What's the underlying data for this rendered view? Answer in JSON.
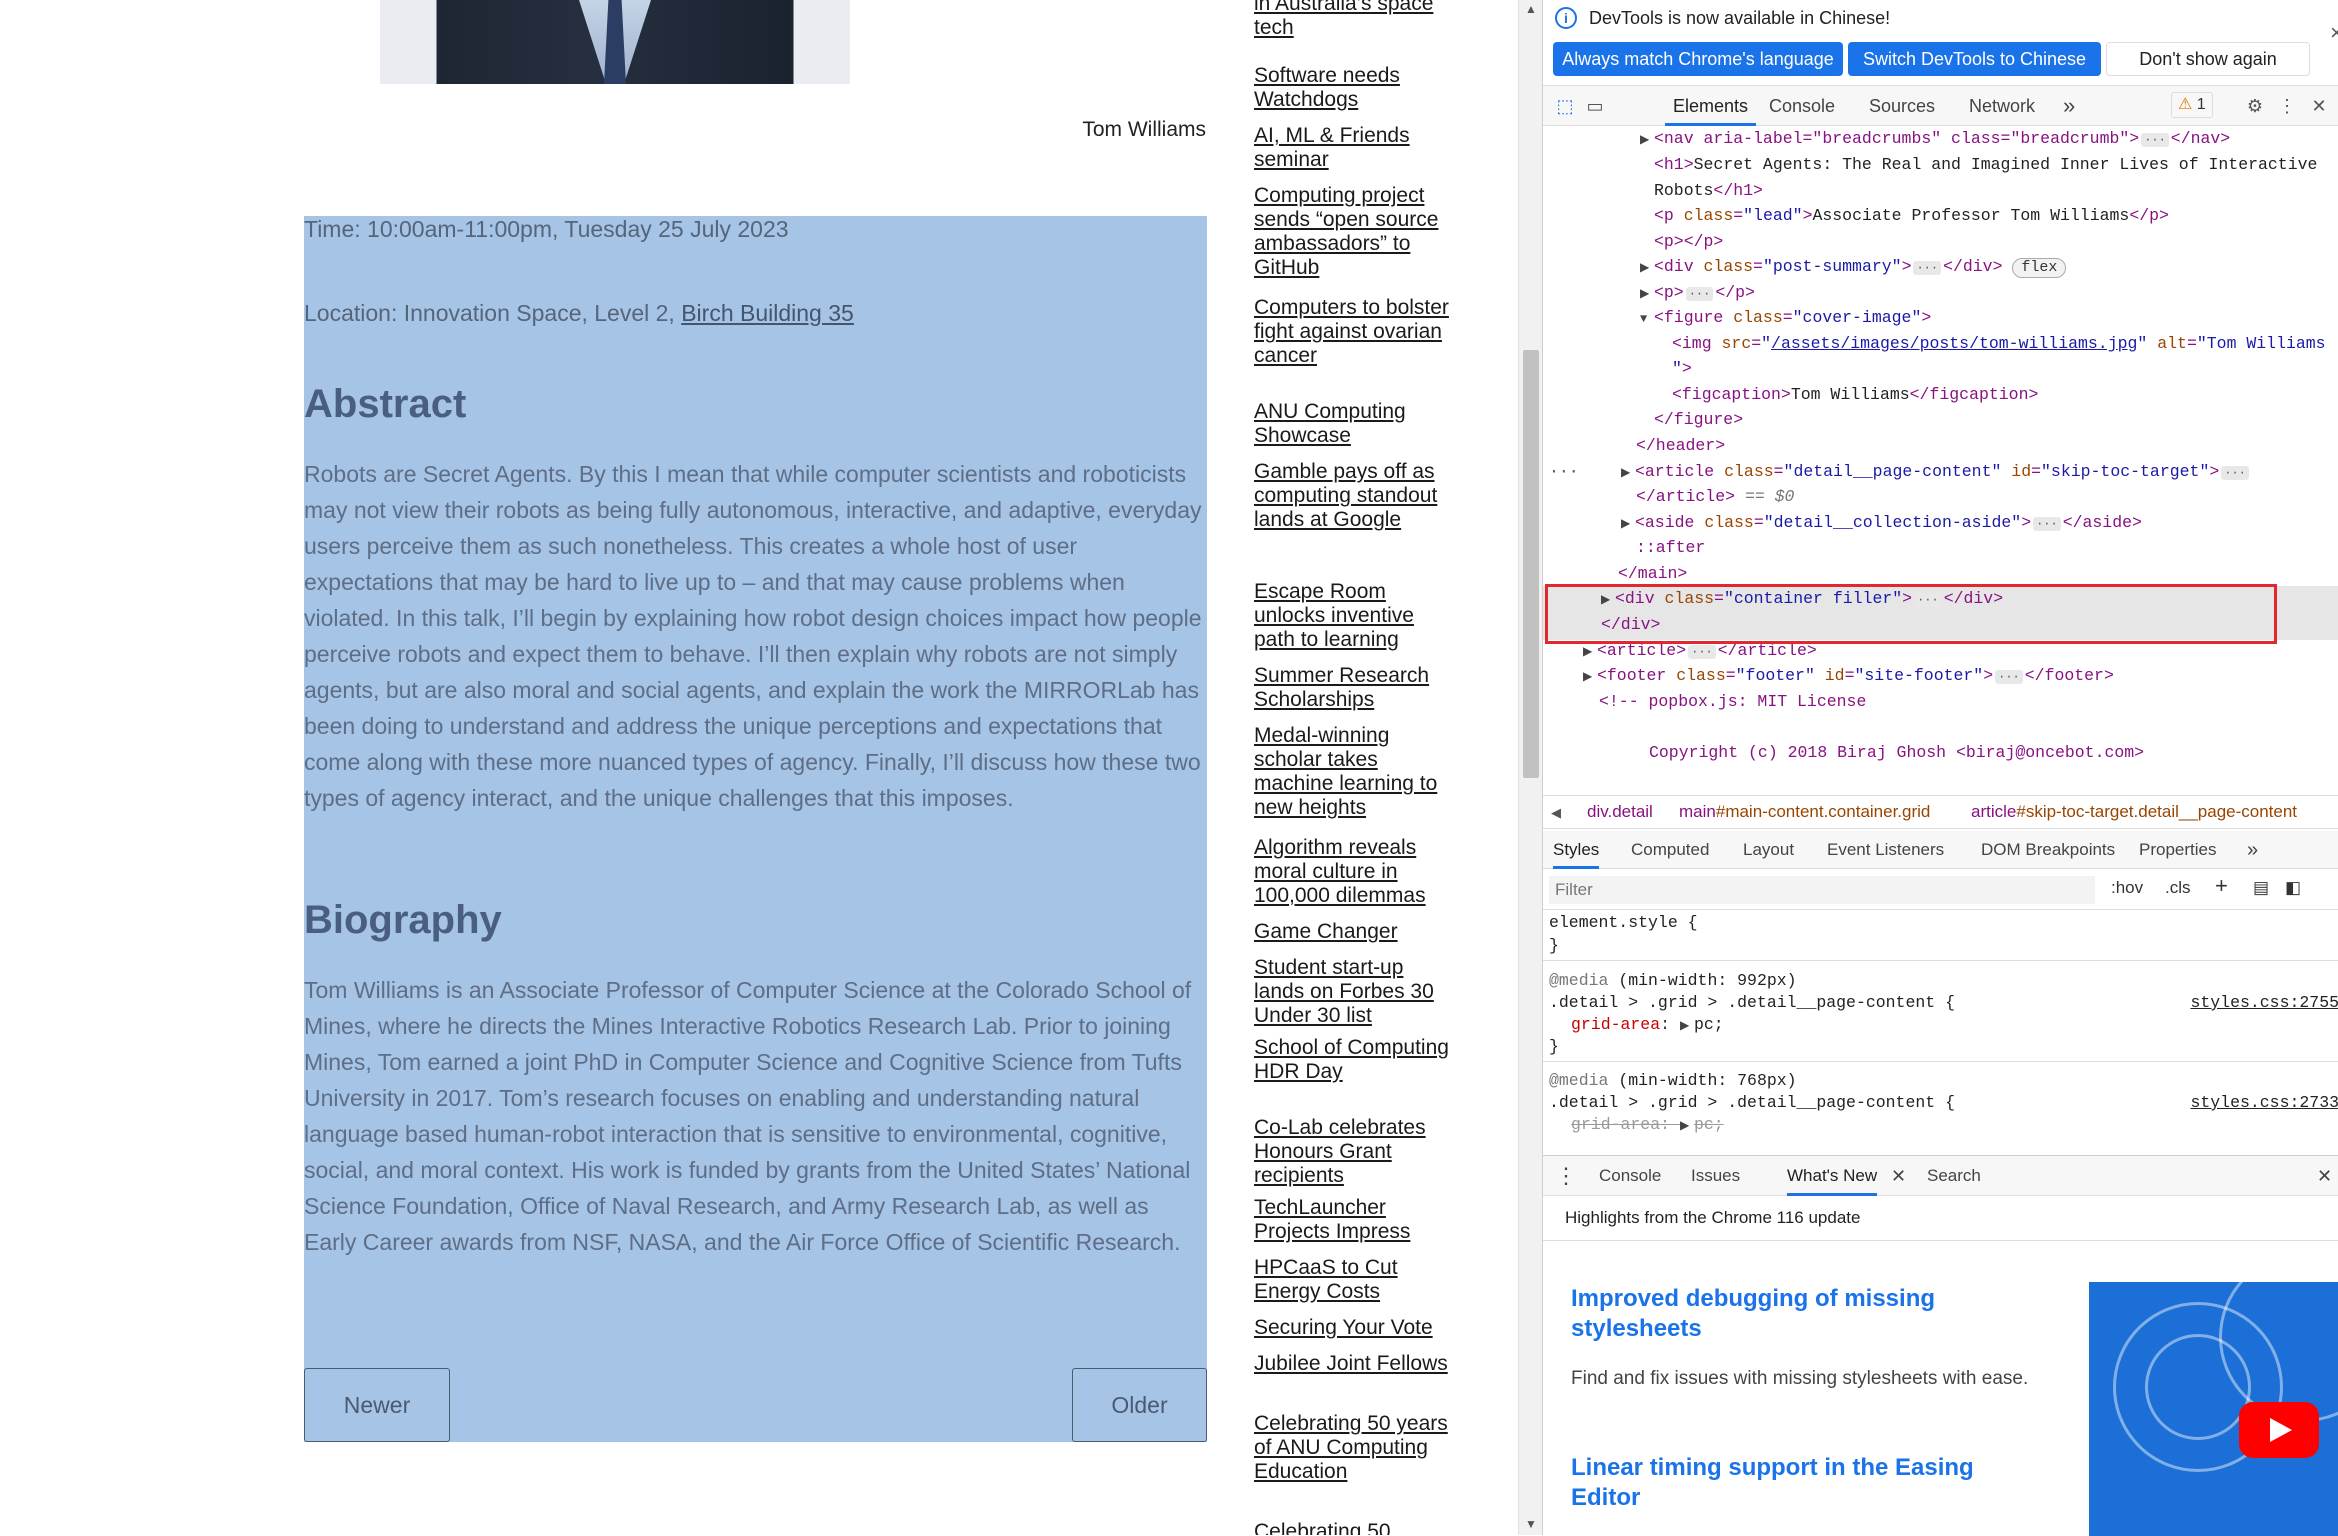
{
  "page": {
    "photo_alt": "Tom Williams",
    "caption": "Tom Williams",
    "article": {
      "time": "Time: 10:00am-11:00pm, Tuesday 25 July 2023",
      "location_prefix": "Location: Innovation Space, Level 2, ",
      "location_link": "Birch Building 35",
      "abstract_heading": "Abstract",
      "abstract_text": "Robots are Secret Agents. By this I mean that while computer scientists and roboticists may not view their robots as being fully autonomous, interactive, and adaptive, everyday users perceive them as such nonetheless. This creates a whole host of user expectations that may be hard to live up to – and that may cause problems when violated. In this talk, I’ll begin by explaining how robot design choices impact how people perceive robots and expect them to behave. I’ll then explain why robots are not simply agents, but are also moral and social agents, and explain the work the MIRRORLab has been doing to understand and address the unique perceptions and expectations that come along with these more nuanced types of agency. Finally, I’ll discuss how these two types of agency interact, and the unique challenges that this imposes.",
      "bio_heading": "Biography",
      "bio_text": "Tom Williams is an Associate Professor of Computer Science at the Colorado School of Mines, where he directs the Mines Interactive Robotics Research Lab. Prior to joining Mines, Tom earned a joint PhD in Computer Science and Cognitive Science from Tufts University in 2017. Tom’s research focuses on enabling and understanding natural language based human-robot interaction that is sensitive to environmental, cognitive, social, and moral context. His work is funded by grants from the United States’ National Science Foundation, Office of Naval Research, and Army Research Lab,  as well as Early Career awards from NSF, NASA, and the Air Force Office of Scientific Research.",
      "newer_label": "Newer",
      "older_label": "Older"
    },
    "aside_links": [
      "in Australia’s space tech",
      "Software needs Watchdogs",
      "AI, ML & Friends seminar",
      "Computing project sends “open source ambassadors” to GitHub",
      "Computers to bolster fight against ovarian cancer",
      "ANU Computing Showcase",
      "Gamble pays off as computing standout lands at Google",
      "Escape Room unlocks inventive path to learning",
      "Summer Research Scholarships",
      "Medal-winning scholar takes machine learning to new heights",
      "Algorithm reveals moral culture in 100,000 dilemmas",
      "Game Changer",
      "Student start-up lands on Forbes 30 Under 30 list",
      "School of Computing HDR Day",
      "Co-Lab celebrates Honours Grant recipients",
      "TechLauncher Projects Impress",
      "HPCaaS to Cut Energy Costs",
      "Securing Your Vote",
      "Jubilee Joint Fellows",
      "Celebrating 50 years of ANU Computing Education",
      "Celebrating 50"
    ]
  },
  "devtools": {
    "infobar": {
      "message": "DevTools is now available in Chinese!",
      "btn_match": "Always match Chrome's language",
      "btn_switch": "Switch DevTools to Chinese",
      "btn_dismiss": "Don't show again",
      "close": "×"
    },
    "tabs": [
      "Elements",
      "Console",
      "Sources",
      "Network"
    ],
    "more_tabs": "»",
    "warning_count": "1",
    "dom": {
      "nav_open": "<nav aria-label=\"breadcrumbs\" class=\"breadcrumb\">",
      "nav_close": "</nav>",
      "h1_line1": "Secret Agents: The Real and Imagined Inner Lives of Interactive",
      "h1_line2": "Robots",
      "p_lead_text": "Associate Professor Tom Williams",
      "img_src": "/assets/images/posts/tom-williams.jpg",
      "img_alt": "Tom Williams",
      "figcaption": "Tom Williams",
      "flex_badge": "flex",
      "eq_label": "== $0",
      "after_pseudo": "::after",
      "comment1": "<!-- popbox.js: MIT License",
      "comment2": "Copyright (c) 2018 Biraj Ghosh <biraj@oncebot.com>"
    },
    "breadcrumbs": {
      "c1": "div.detail",
      "c2a": "main",
      "c2b": "#main-content.container.grid",
      "c3a": "article",
      "c3b": "#skip-toc-target.detail__page-content"
    },
    "styles_tabs": [
      "Styles",
      "Computed",
      "Layout",
      "Event Listeners",
      "DOM Breakpoints",
      "Properties"
    ],
    "filter_placeholder": "Filter",
    "hov": ":hov",
    "cls": ".cls",
    "rules": {
      "element_style": "element.style {",
      "close_brace": "}",
      "media1": "(min-width: 992px)",
      "media2": "(min-width: 768px)",
      "selector": ".detail > .grid > .detail__page-content {",
      "prop": "grid-area",
      "value": "pc;",
      "src1": "styles.css:2755",
      "src2": "styles.css:2733"
    },
    "drawer": {
      "tabs": [
        "Console",
        "Issues",
        "What's New",
        "Search"
      ],
      "subtitle": "Highlights from the Chrome 116 update",
      "item1_title": "Improved debugging of missing stylesheets",
      "item1_desc": "Find and fix issues with missing stylesheets with ease.",
      "item2_title": "Linear timing support in the Easing Editor"
    }
  }
}
